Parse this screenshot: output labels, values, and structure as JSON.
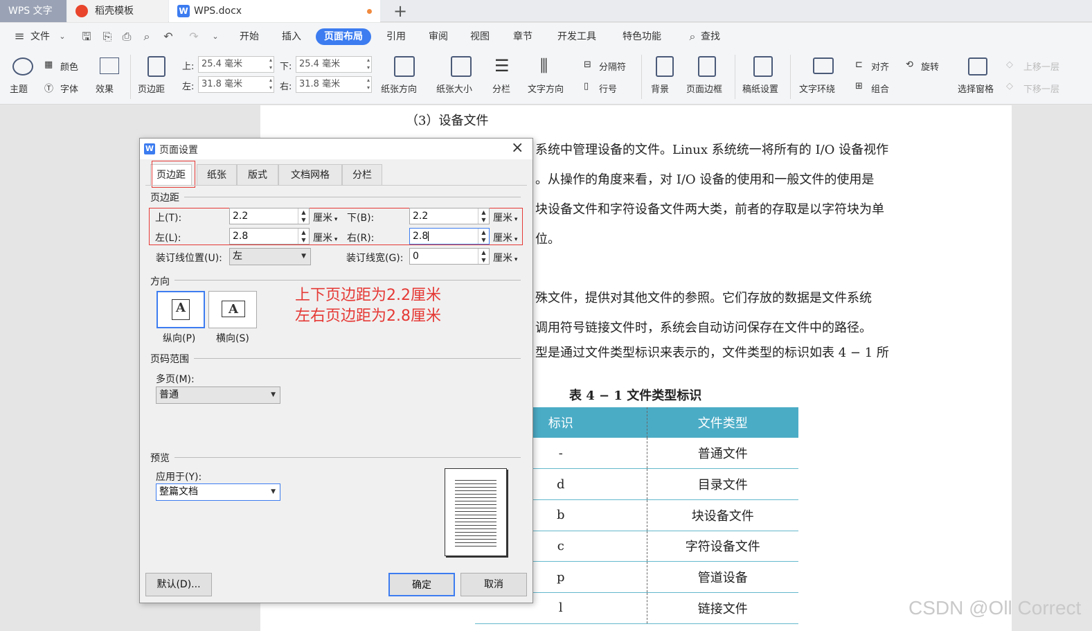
{
  "tabs": {
    "app": "WPS 文字",
    "template": "稻壳模板",
    "doc": "WPS.docx",
    "new_tab": "+"
  },
  "menu": {
    "file": "文件",
    "items": [
      "开始",
      "插入",
      "页面布局",
      "引用",
      "审阅",
      "视图",
      "章节",
      "开发工具",
      "特色功能"
    ],
    "active": "页面布局",
    "search": "查找"
  },
  "toolbar": {
    "theme": "主题",
    "color": "颜色",
    "font": "字体",
    "effect": "效果",
    "margins": "页边距",
    "top_label": "上:",
    "top_value": "25.4 毫米",
    "bottom_label": "下:",
    "bottom_value": "25.4 毫米",
    "left_label": "左:",
    "left_value": "31.8 毫米",
    "right_label": "右:",
    "right_value": "31.8 毫米",
    "orientation": "纸张方向",
    "size": "纸张大小",
    "columns": "分栏",
    "text_direction": "文字方向",
    "breaks": "分隔符",
    "line_numbers": "行号",
    "background": "背景",
    "page_border": "页面边框",
    "manuscript": "稿纸设置",
    "wrap": "文字环绕",
    "align": "对齐",
    "rotate": "旋转",
    "group": "组合",
    "selection_pane": "选择窗格",
    "bring_forward": "上移一层",
    "send_backward": "下移一层"
  },
  "document": {
    "heading": "（3）设备文件",
    "lines": [
      "系统中管理设备的文件。Linux 系统统一将所有的 I/O 设备视作",
      "。从操作的角度来看，对 I/O 设备的使用和一般文件的使用是",
      "块设备文件和字符设备文件两大类，前者的存取是以字符块为单",
      "位。",
      "殊文件，提供对其他文件的参照。它们存放的数据是文件系统",
      "调用符号链接文件时，系统会自动访问保存在文件中的路径。",
      "型是通过文件类型标识来表示的，文件类型的标识如表 4 − 1 所"
    ],
    "table_caption": "表 4 − 1 文件类型标识",
    "table": {
      "headers": [
        "标识",
        "文件类型"
      ],
      "rows": [
        [
          "-",
          "普通文件"
        ],
        [
          "d",
          "目录文件"
        ],
        [
          "b",
          "块设备文件"
        ],
        [
          "c",
          "字符设备文件"
        ],
        [
          "p",
          "管道设备"
        ],
        [
          "l",
          "链接文件"
        ]
      ]
    },
    "watermark": "CSDN @Oll Correct"
  },
  "dialog": {
    "title": "页面设置",
    "tabs": [
      "页边距",
      "纸张",
      "版式",
      "文档网格",
      "分栏"
    ],
    "section_margins": "页边距",
    "top_label": "上(T):",
    "top_value": "2.2",
    "bottom_label": "下(B):",
    "bottom_value": "2.2",
    "left_label": "左(L):",
    "left_value": "2.8",
    "right_label": "右(R):",
    "right_value": "2.8",
    "unit": "厘米",
    "gutter_pos_label": "装订线位置(U):",
    "gutter_pos_value": "左",
    "gutter_width_label": "装订线宽(G):",
    "gutter_width_value": "0",
    "section_orientation": "方向",
    "portrait": "纵向(P)",
    "landscape": "横向(S)",
    "annotation_line1": "上下页边距为2.2厘米",
    "annotation_line2": "左右页边距为2.8厘米",
    "section_pages": "页码范围",
    "multiple_pages_label": "多页(M):",
    "multiple_pages_value": "普通",
    "section_preview": "预览",
    "apply_to_label": "应用于(Y):",
    "apply_to_value": "整篇文档",
    "default_button": "默认(D)...",
    "ok_button": "确定",
    "cancel_button": "取消"
  },
  "colors": {
    "accent": "#3c7cf0",
    "table_header": "#4bacc6",
    "annotation": "#e53935"
  }
}
